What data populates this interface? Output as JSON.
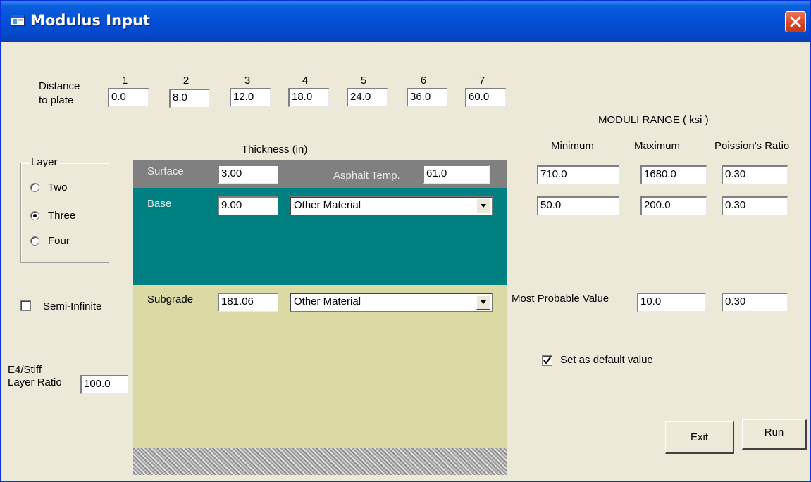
{
  "window": {
    "title": "Modulus Input",
    "close_icon": "close-icon",
    "app_icon": "app-window-icon"
  },
  "distance": {
    "label_line1": "Distance",
    "label_line2": "to plate",
    "columns": [
      "1",
      "2",
      "3",
      "4",
      "5",
      "6",
      "7"
    ],
    "values": [
      "0.0",
      "8.0",
      "12.0",
      "18.0",
      "24.0",
      "36.0",
      "60.0"
    ]
  },
  "thickness_header": "Thickness (in)",
  "layer_group": {
    "label": "Layer",
    "options": [
      "Two",
      "Three",
      "Four"
    ],
    "selected": "Three"
  },
  "semi_infinite": {
    "label": "Semi-Infinite",
    "checked": false
  },
  "e4": {
    "label_line1": "E4/Stiff",
    "label_line2": "Layer Ratio",
    "value": "100.0"
  },
  "layers": {
    "surface": {
      "name": "Surface",
      "thickness": "3.00",
      "temp_label": "Asphalt Temp.",
      "temp_value": "61.0",
      "color": "#808080"
    },
    "base": {
      "name": "Base",
      "thickness": "9.00",
      "material": "Other Material",
      "color": "#008080"
    },
    "subgrade": {
      "name": "Subgrade",
      "thickness": "181.06",
      "material": "Other Material",
      "color": "#dbd9a4"
    }
  },
  "moduli": {
    "title": "MODULI RANGE  ( ksi )",
    "headers": [
      "Minimum",
      "Maximum",
      "Poission's Ratio"
    ],
    "surface": {
      "min": "710.0",
      "max": "1680.0",
      "ratio": "0.30"
    },
    "base": {
      "min": "50.0",
      "max": "200.0",
      "ratio": "0.30"
    },
    "most_probable_label": "Most Probable Value",
    "most_probable": {
      "value": "10.0",
      "ratio": "0.30"
    }
  },
  "default_check": {
    "label": "Set as default value",
    "checked": true
  },
  "buttons": {
    "exit": "Exit",
    "run": "Run"
  }
}
